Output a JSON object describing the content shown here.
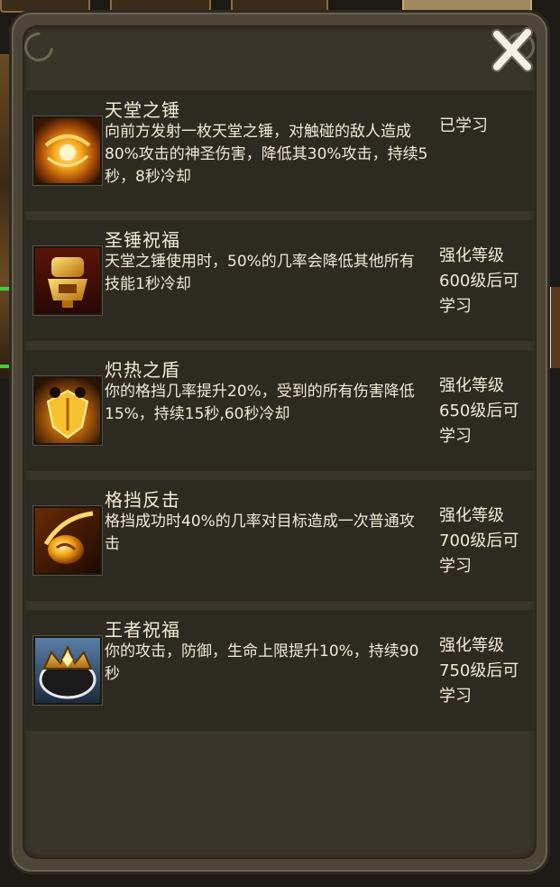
{
  "dialog": {
    "close_icon": "close-x-icon"
  },
  "skills": [
    {
      "name": "天堂之锤",
      "icon": "heaven-hammer-icon",
      "desc": "向前方发射一枚天堂之锤，对触碰的敌人造成80%攻击的神圣伤害，降低其30%攻击，持续5秒，8秒冷却",
      "status": "已学习"
    },
    {
      "name": "圣锤祝福",
      "icon": "holy-hammer-blessing-icon",
      "desc": "天堂之锤使用时，50%的几率会降低其他所有技能1秒冷却",
      "status": "强化等级600级后可学习"
    },
    {
      "name": "炽热之盾",
      "icon": "blazing-shield-icon",
      "desc": "你的格挡几率提升20%，受到的所有伤害降低15%，持续15秒,60秒冷却",
      "status": "强化等级650级后可学习"
    },
    {
      "name": "格挡反击",
      "icon": "block-counter-icon",
      "desc": "格挡成功时40%的几率对目标造成一次普通攻击",
      "status": "强化等级700级后可学习"
    },
    {
      "name": "王者祝福",
      "icon": "king-blessing-icon",
      "desc": "你的攻击，防御，生命上限提升10%，持续90秒",
      "status": "强化等级750级后可学习"
    }
  ],
  "colors": {
    "panel": "#3a352a",
    "row": "#2d2a22",
    "text": "#f1e9d6"
  }
}
